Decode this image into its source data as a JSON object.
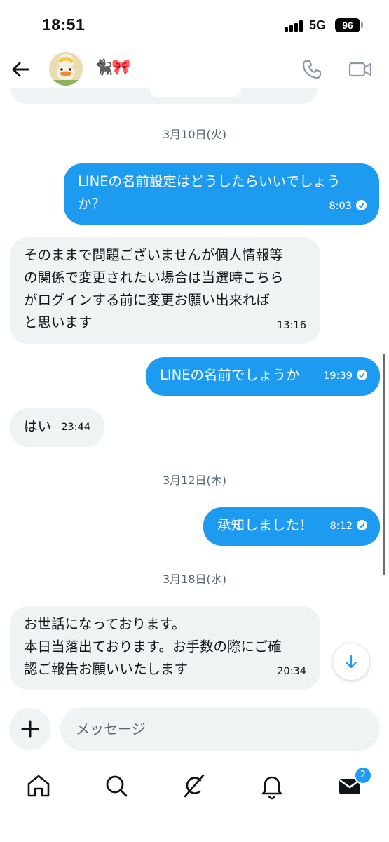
{
  "status_bar": {
    "time": "18:51",
    "network": "5G",
    "battery": "96"
  },
  "header": {
    "name": "🐈‍⬛🎀"
  },
  "messages": [
    {
      "type": "date",
      "text": "3月10日(火)"
    },
    {
      "type": "out",
      "text": "LINEの名前設定はどうしたらいいでしょう\nか？",
      "time": "8:03"
    },
    {
      "type": "in",
      "text": "そのままで問題ございませんが個人情報等\nの関係で変更されたい場合は当選時こちら\nがログインする前に変更お願い出来れば\nと思います",
      "time": "13:16"
    },
    {
      "type": "out",
      "text": "LINEの名前でしょうか",
      "time": "19:39"
    },
    {
      "type": "in",
      "text": "はい",
      "time": "23:44"
    },
    {
      "type": "date",
      "text": "3月12日(木)"
    },
    {
      "type": "out",
      "text": "承知しました！",
      "time": "8:12"
    },
    {
      "type": "date",
      "text": "3月18日(水)"
    },
    {
      "type": "in",
      "text": "お世話になっております。\n本日当落出ております。お手数の際にご確\n認ご報告お願いいたします",
      "time": "20:34"
    }
  ],
  "composer": {
    "placeholder": "メッセージ"
  },
  "bottom_nav": {
    "messages_badge": "2"
  },
  "colors": {
    "accent": "#1d9bf0",
    "incoming_bubble": "#eff3f4",
    "secondary_text": "#536471"
  },
  "icons": [
    "back-arrow-icon",
    "phone-icon",
    "video-icon",
    "plus-icon",
    "scroll-down-icon",
    "home-icon",
    "search-icon",
    "grok-icon",
    "bell-icon",
    "mail-icon"
  ]
}
